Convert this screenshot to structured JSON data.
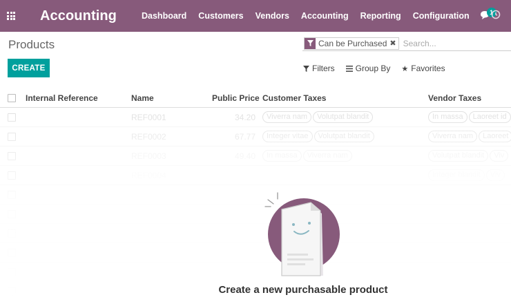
{
  "app": {
    "name": "Accounting"
  },
  "menu": [
    "Dashboard",
    "Customers",
    "Vendors",
    "Accounting",
    "Reporting",
    "Configuration"
  ],
  "notifications": {
    "count": "1"
  },
  "page": {
    "title": "Products"
  },
  "search": {
    "facet_label": "Can be Purchased",
    "facet_close": "✖",
    "placeholder": "Search..."
  },
  "toolbar": {
    "create_label": "CREATE",
    "filters_label": "Filters",
    "groupby_label": "Group By",
    "favorites_label": "Favorites"
  },
  "table": {
    "columns": [
      "Internal Reference",
      "Name",
      "Public Price",
      "Customer Taxes",
      "Vendor Taxes"
    ],
    "rows": [
      {
        "ref": "REF0001",
        "price": "34.20",
        "customer_taxes": [
          "Viverra nam",
          "Volutpat blandit"
        ],
        "vendor_taxes": [
          "In massa",
          "Laoreet id"
        ]
      },
      {
        "ref": "REF0002",
        "price": "67.77",
        "customer_taxes": [
          "Integer vitae",
          "Volutpat blandit"
        ],
        "vendor_taxes": [
          "Viverra nam",
          "Laoreet"
        ]
      },
      {
        "ref": "REF0003",
        "price": "49.40",
        "customer_taxes": [
          "In massa",
          "Viverra nam"
        ],
        "vendor_taxes": [
          "Volutpat blandit",
          "Viv"
        ]
      },
      {
        "ref": "REF0004",
        "price": "",
        "customer_taxes": [],
        "vendor_taxes": [
          "Integer blandit",
          "Viv"
        ]
      }
    ],
    "empty_row_count": 6
  },
  "helper": {
    "title": "Create a new purchasable product"
  },
  "colors": {
    "brand": "#875a7b",
    "accent": "#00a09d"
  }
}
